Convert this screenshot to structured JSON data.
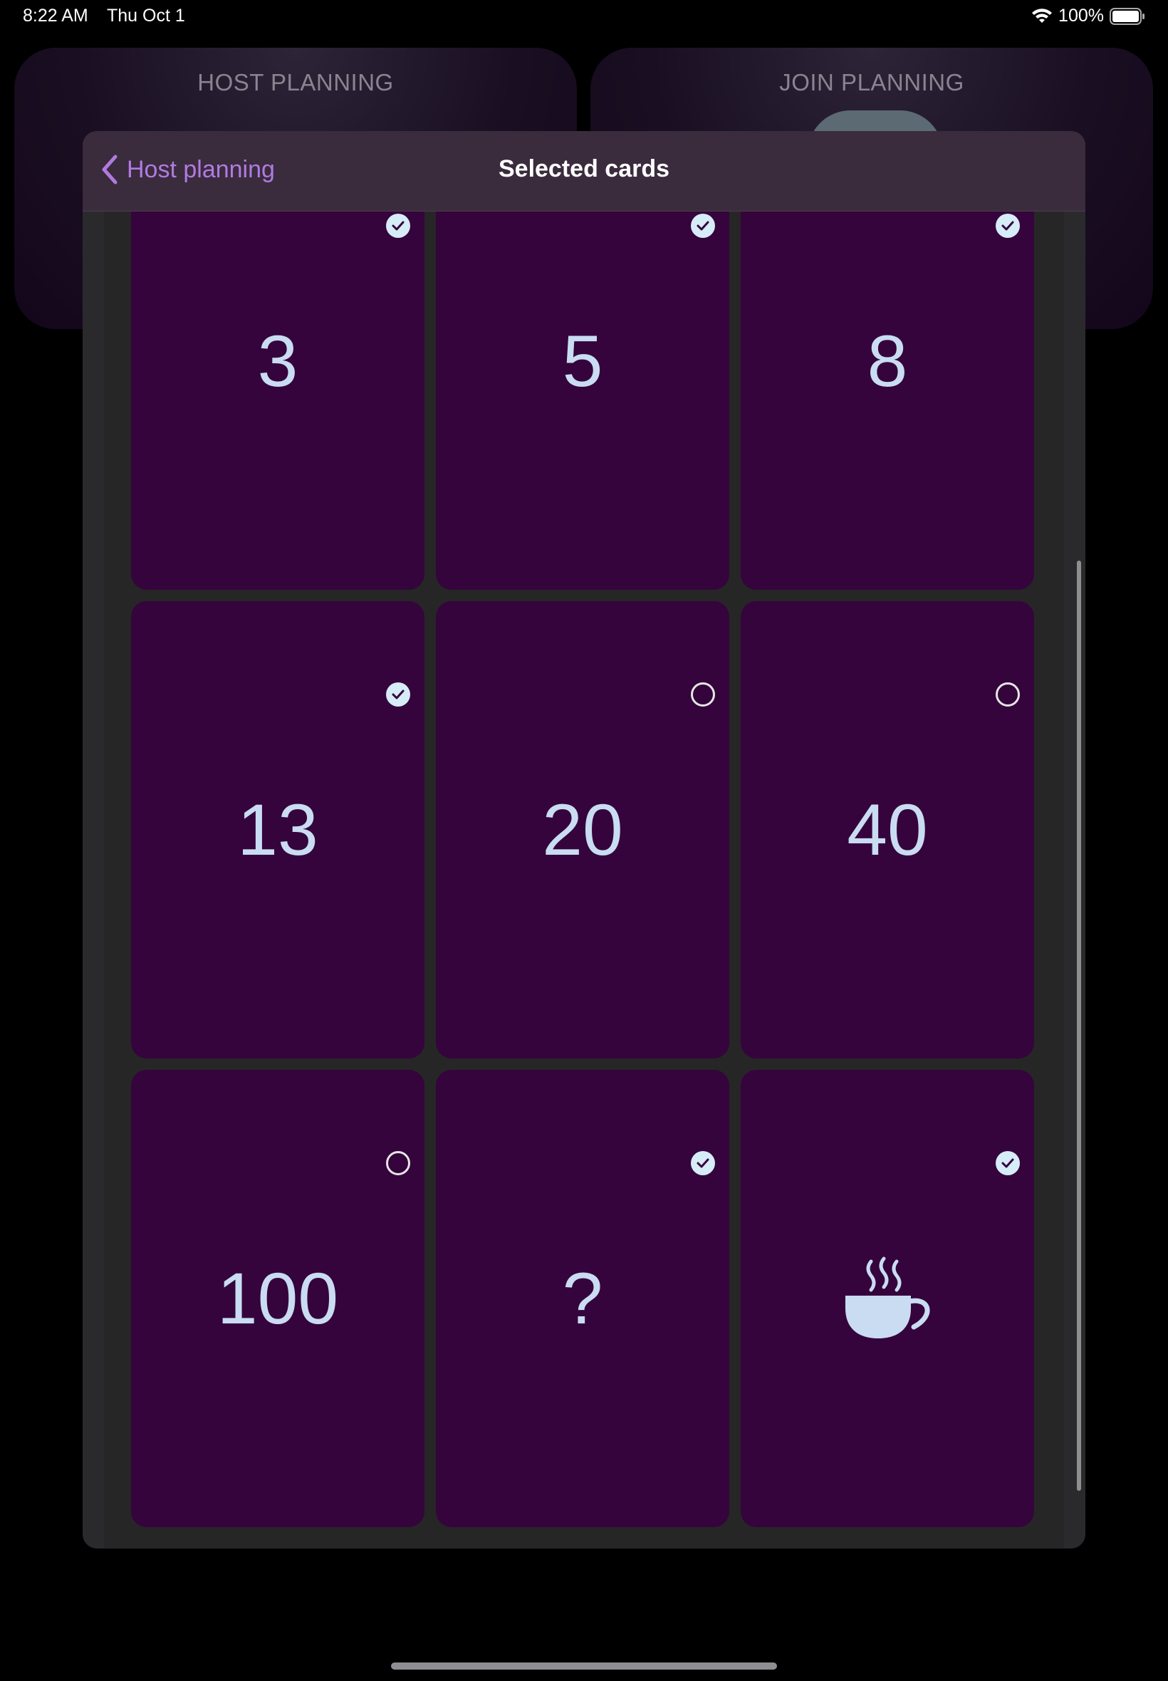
{
  "status_bar": {
    "time": "8:22 AM",
    "date": "Thu Oct 1",
    "battery": "100%"
  },
  "background": {
    "host_title": "HOST PLANNING",
    "join_title": "JOIN PLANNING"
  },
  "sheet": {
    "back_label": "Host planning",
    "title": "Selected cards"
  },
  "cards": [
    {
      "value": "3",
      "selected": true
    },
    {
      "value": "5",
      "selected": true
    },
    {
      "value": "8",
      "selected": true
    },
    {
      "value": "13",
      "selected": true
    },
    {
      "value": "20",
      "selected": false
    },
    {
      "value": "40",
      "selected": false
    },
    {
      "value": "100",
      "selected": false
    },
    {
      "value": "?",
      "selected": true
    },
    {
      "value": "",
      "icon": "coffee-cup-icon",
      "selected": true
    }
  ],
  "colors": {
    "card_bg": "#35043c",
    "card_text": "#c9dcf2",
    "accent": "#b07be0"
  }
}
